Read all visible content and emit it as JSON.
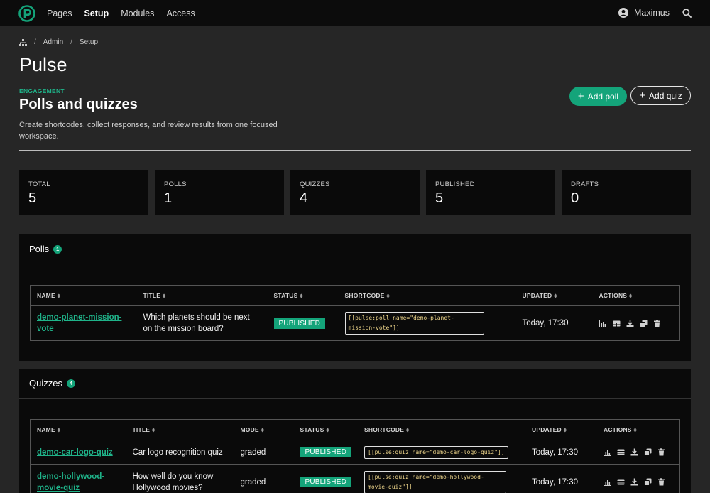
{
  "nav": {
    "links": [
      "Pages",
      "Setup",
      "Modules",
      "Access"
    ],
    "active": "Setup",
    "user_name": "Maximus",
    "brand_color": "#14a47a"
  },
  "breadcrumb": [
    "Admin",
    "Setup"
  ],
  "page_title": "Pulse",
  "header": {
    "eyebrow": "ENGAGEMENT",
    "title": "Polls and quizzes",
    "lead": "Create shortcodes, collect responses, and review results from one focused workspace.",
    "add_poll_label": "Add poll",
    "add_quiz_label": "Add quiz"
  },
  "stats": [
    {
      "label": "TOTAL",
      "value": "5"
    },
    {
      "label": "POLLS",
      "value": "1"
    },
    {
      "label": "QUIZZES",
      "value": "4"
    },
    {
      "label": "PUBLISHED",
      "value": "5"
    },
    {
      "label": "DRAFTS",
      "value": "0"
    }
  ],
  "polls": {
    "title": "Polls",
    "count": "1",
    "columns": [
      "NAME",
      "TITLE",
      "STATUS",
      "SHORTCODE",
      "UPDATED",
      "ACTIONS"
    ],
    "rows": [
      {
        "name": "demo-planet-mission-vote",
        "title": "Which planets should be next on the mission board?",
        "status": "PUBLISHED",
        "shortcode": "[[pulse:poll name=\"demo-planet-mission-vote\"]]",
        "updated": "Today, 17:30"
      }
    ]
  },
  "quizzes": {
    "title": "Quizzes",
    "count": "4",
    "columns": [
      "NAME",
      "TITLE",
      "MODE",
      "STATUS",
      "SHORTCODE",
      "UPDATED",
      "ACTIONS"
    ],
    "rows": [
      {
        "name": "demo-car-logo-quiz",
        "title": "Car logo recognition quiz",
        "mode": "graded",
        "status": "PUBLISHED",
        "shortcode": "[[pulse:quiz name=\"demo-car-logo-quiz\"]]",
        "updated": "Today, 17:30"
      },
      {
        "name": "demo-hollywood-movie-quiz",
        "title": "How well do you know Hollywood movies?",
        "mode": "graded",
        "status": "PUBLISHED",
        "shortcode": "[[pulse:quiz name=\"demo-hollywood-movie-quiz\"]]",
        "updated": "Today, 17:30"
      }
    ]
  },
  "row_action_icons": [
    "bar-chart-icon",
    "table-icon",
    "download-icon",
    "copy-icon",
    "trash-icon"
  ]
}
